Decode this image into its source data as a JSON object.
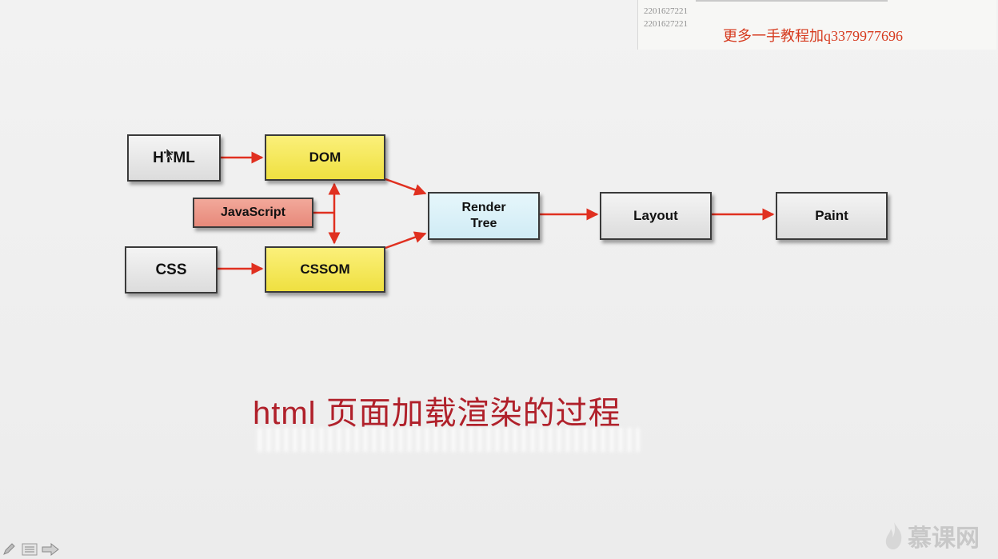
{
  "watermark": {
    "ids": [
      "2201627221",
      "2201627221"
    ],
    "promo": "更多一手教程加q3379977696"
  },
  "diagram": {
    "nodes": {
      "html": "HTML",
      "dom": "DOM",
      "javascript": "JavaScript",
      "css": "CSS",
      "cssom": "CSSOM",
      "render_tree": "Render\nTree",
      "layout": "Layout",
      "paint": "Paint"
    },
    "colors": {
      "arrow": "#e03020",
      "yellow": "#f2e34a",
      "gray": "#e6e6e6",
      "red": "#ea9180",
      "blue": "#d8f0f7"
    }
  },
  "caption": "html 页面加载渲染的过程",
  "brand": {
    "name": "慕课网",
    "icon": "flame-icon"
  },
  "player_controls": [
    "pencil-icon",
    "menu-icon",
    "next-arrow-icon"
  ]
}
